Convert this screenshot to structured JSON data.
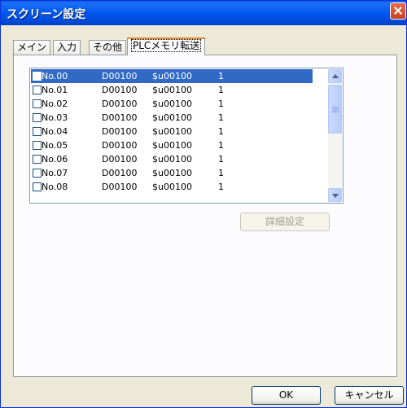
{
  "window": {
    "title": "スクリーン設定"
  },
  "tabs": [
    {
      "label": "メイン"
    },
    {
      "label": "入力"
    },
    {
      "label": "その他"
    },
    {
      "label": "PLCメモリ転送"
    }
  ],
  "list": {
    "rows": [
      {
        "no": "No.00",
        "device": "D00100",
        "var": "$u00100",
        "count": "1",
        "checked": false,
        "selected": true
      },
      {
        "no": "No.01",
        "device": "D00100",
        "var": "$u00100",
        "count": "1",
        "checked": false,
        "selected": false
      },
      {
        "no": "No.02",
        "device": "D00100",
        "var": "$u00100",
        "count": "1",
        "checked": false,
        "selected": false
      },
      {
        "no": "No.03",
        "device": "D00100",
        "var": "$u00100",
        "count": "1",
        "checked": false,
        "selected": false
      },
      {
        "no": "No.04",
        "device": "D00100",
        "var": "$u00100",
        "count": "1",
        "checked": false,
        "selected": false
      },
      {
        "no": "No.05",
        "device": "D00100",
        "var": "$u00100",
        "count": "1",
        "checked": false,
        "selected": false
      },
      {
        "no": "No.06",
        "device": "D00100",
        "var": "$u00100",
        "count": "1",
        "checked": false,
        "selected": false
      },
      {
        "no": "No.07",
        "device": "D00100",
        "var": "$u00100",
        "count": "1",
        "checked": false,
        "selected": false
      },
      {
        "no": "No.08",
        "device": "D00100",
        "var": "$u00100",
        "count": "1",
        "checked": false,
        "selected": false
      }
    ]
  },
  "buttons": {
    "detail": "詳細設定",
    "ok": "OK",
    "cancel": "キャンセル"
  },
  "colors": {
    "titlebar": "#0058ee",
    "selection": "#316ac5",
    "active_tab_highlight": "#e68b2c"
  }
}
